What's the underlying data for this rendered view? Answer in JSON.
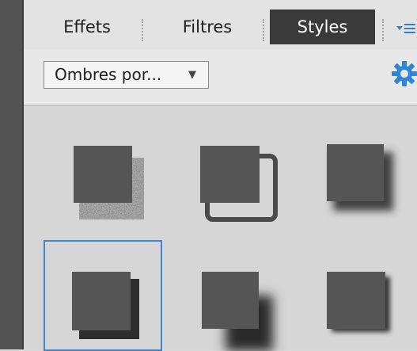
{
  "tabs": [
    {
      "label": "Effets",
      "active": false
    },
    {
      "label": "Filtres",
      "active": false
    },
    {
      "label": "Styles",
      "active": true
    }
  ],
  "panel_menu_icon": "panel-menu-icon",
  "category_dropdown": {
    "value": "Ombres por...",
    "icon": "chevron-down-icon"
  },
  "settings_icon": "gear-icon",
  "colors": {
    "accent": "#3e86d1",
    "active_tab": "#3a3a3a",
    "swatch": "#555555",
    "gear": "#2f86d6"
  },
  "styles": [
    {
      "name": "noise-shadow",
      "selected": false
    },
    {
      "name": "outline-shadow",
      "selected": false
    },
    {
      "name": "soft-shadow",
      "selected": false
    },
    {
      "name": "hard-shadow",
      "selected": true
    },
    {
      "name": "corner-shadow",
      "selected": false
    },
    {
      "name": "edge-shadow",
      "selected": false
    }
  ]
}
